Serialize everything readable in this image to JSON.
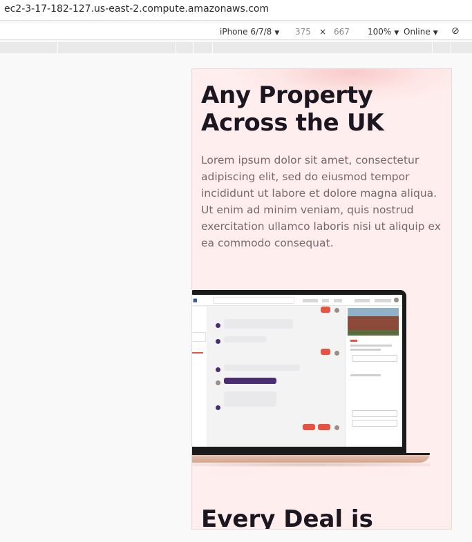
{
  "browser": {
    "url": "ec2-3-17-182-127.us-east-2.compute.amazonaws.com"
  },
  "devtools": {
    "device": "iPhone 6/7/8",
    "width": "375",
    "times": "×",
    "height": "667",
    "zoom": "100%",
    "network": "Online",
    "caret": "▼",
    "rotate_icon": "⊘"
  },
  "hero": {
    "title": "Any Property Across the UK",
    "body": "Lorem ipsum dolor sit amet, consectetur adipiscing elit, sed do eiusmod tempor incididunt ut labore et dolore magna aliqua. Ut enim ad minim veniam, quis nostrud exercitation ullamco laboris nisi ut aliquip ex ea commodo consequat.",
    "next_title": "Every Deal is"
  },
  "colors": {
    "page_bg": "#ffeeed",
    "heading": "#1b1620",
    "body_text": "#75686d",
    "accent_red": "#e55443",
    "accent_purple": "#4c2d74"
  }
}
